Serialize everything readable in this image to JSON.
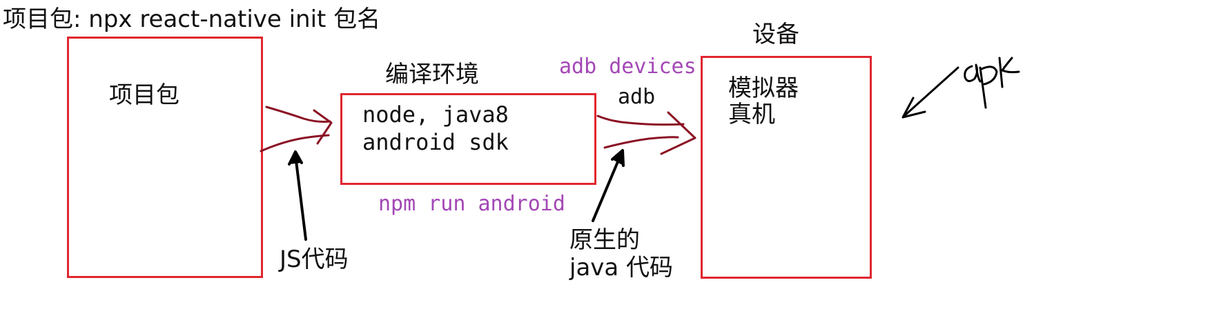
{
  "title": "项目包: npx react-native init 包名",
  "boxes": {
    "project": {
      "label": "项目包"
    },
    "compile": {
      "heading": "编译环境",
      "line1": "node, java8",
      "line2": "android sdk"
    },
    "device": {
      "heading": "设备",
      "line1": "模拟器",
      "line2": "真机"
    }
  },
  "annotations": {
    "js_code": "JS代码",
    "npm_run": "npm run android",
    "adb_devices": "adb devices",
    "adb": "adb",
    "native_line1": "原生的",
    "native_line2": "java 代码",
    "apk": "apk"
  },
  "colors": {
    "box_border": "#e0262f",
    "arrow_ink": "#8b1224",
    "pointer_ink": "#000000",
    "command_text": "#a347b5",
    "text": "#111111"
  }
}
